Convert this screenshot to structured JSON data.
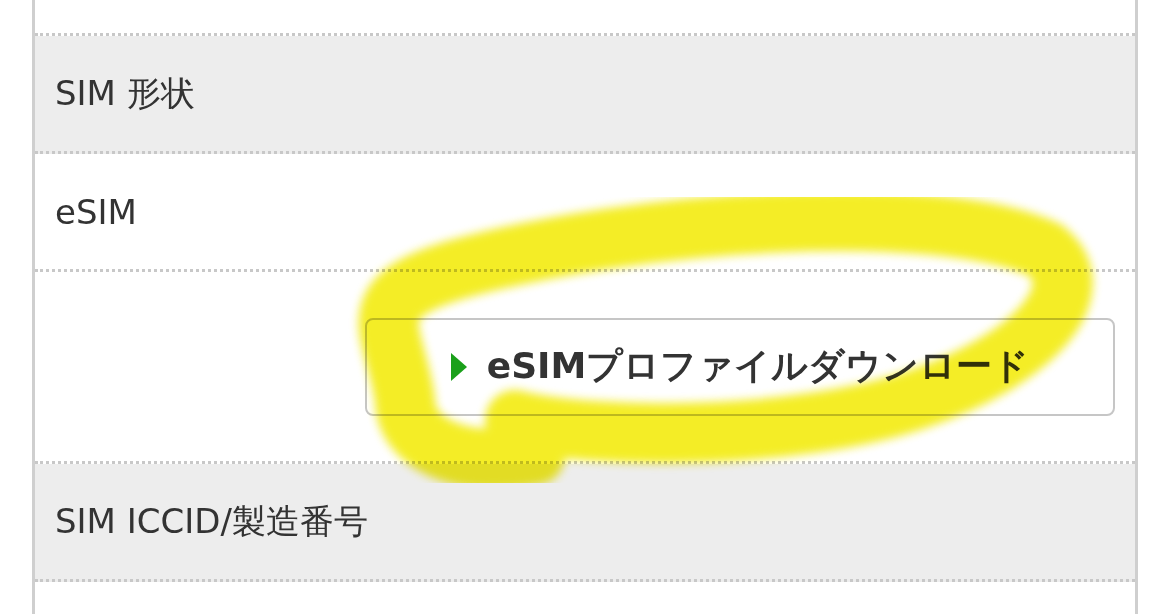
{
  "rows": [
    {
      "kind": "header",
      "label": "SIM 形状"
    },
    {
      "kind": "value",
      "label": "eSIM"
    },
    {
      "kind": "button",
      "label": "eSIMプロファイルダウンロード"
    },
    {
      "kind": "header",
      "label": "SIM ICCID/製造番号"
    }
  ],
  "annotation": {
    "kind": "marker"
  }
}
